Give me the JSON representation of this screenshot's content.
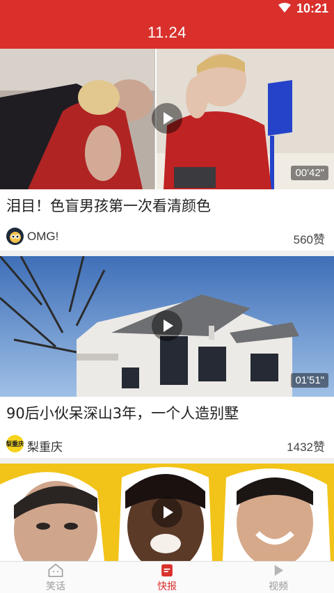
{
  "status_bar": {
    "time": "10:21"
  },
  "app_bar": {
    "title": "11.24"
  },
  "feed": {
    "items": [
      {
        "title": "泪目！色盲男孩第一次看清颜色",
        "source": "OMG!",
        "likes": "560赞",
        "duration": "00'42\""
      },
      {
        "title": "90后小伙呆深山3年，一个人造别墅",
        "source": "梨重庆",
        "likes": "1432赞",
        "duration": "01'51\"",
        "source_logo_text": "梨重庆"
      },
      {
        "title": "",
        "source": "",
        "likes": "",
        "duration": ""
      }
    ]
  },
  "tabs": [
    {
      "label": "笑话",
      "icon": "home-face-icon",
      "active": false
    },
    {
      "label": "快报",
      "icon": "news-icon",
      "active": true
    },
    {
      "label": "视频",
      "icon": "video-play-icon",
      "active": false
    }
  ],
  "colors": {
    "brand_red": "#d9302c",
    "inactive_gray": "#999999"
  }
}
